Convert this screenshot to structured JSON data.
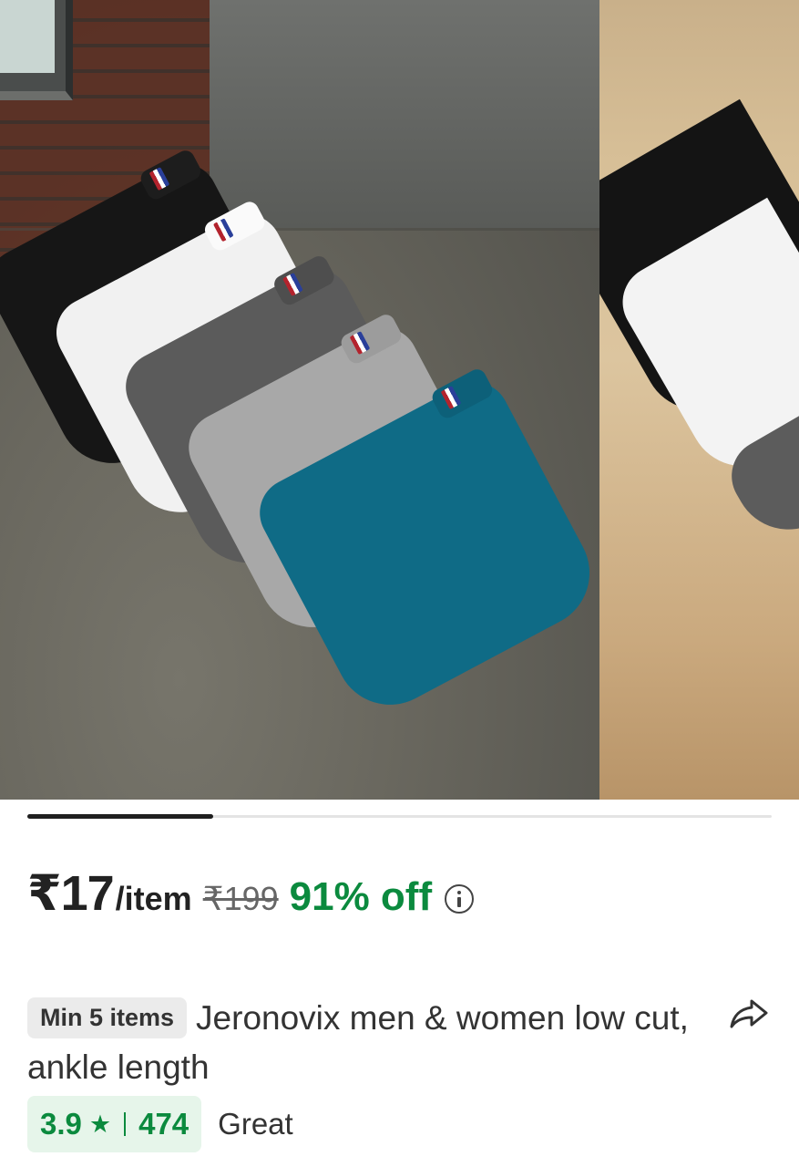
{
  "gallery": {
    "main_image": "socks-product-photo",
    "next_image": "socks-product-photo-alt",
    "current_slide": 1,
    "total_slides": 4,
    "progress": 0.25,
    "sock_colors": [
      "#151515",
      "#f2f2f2",
      "#5a5a5a",
      "#a7a7a7",
      "#0f6b86"
    ]
  },
  "pricing": {
    "price": "₹17",
    "unit": "/item",
    "mrp": "₹199",
    "discount": "91% off",
    "info_icon": "info-icon",
    "discount_color": "#0b8a3e"
  },
  "product": {
    "min_order_badge": "Min 5 items",
    "title": "Jeronovix men & women low cut, ankle length",
    "share_icon": "share-arrow-icon"
  },
  "rating": {
    "value": "3.9",
    "star": "★",
    "count": "474",
    "label": "Great",
    "color": "#0b8a3e"
  }
}
